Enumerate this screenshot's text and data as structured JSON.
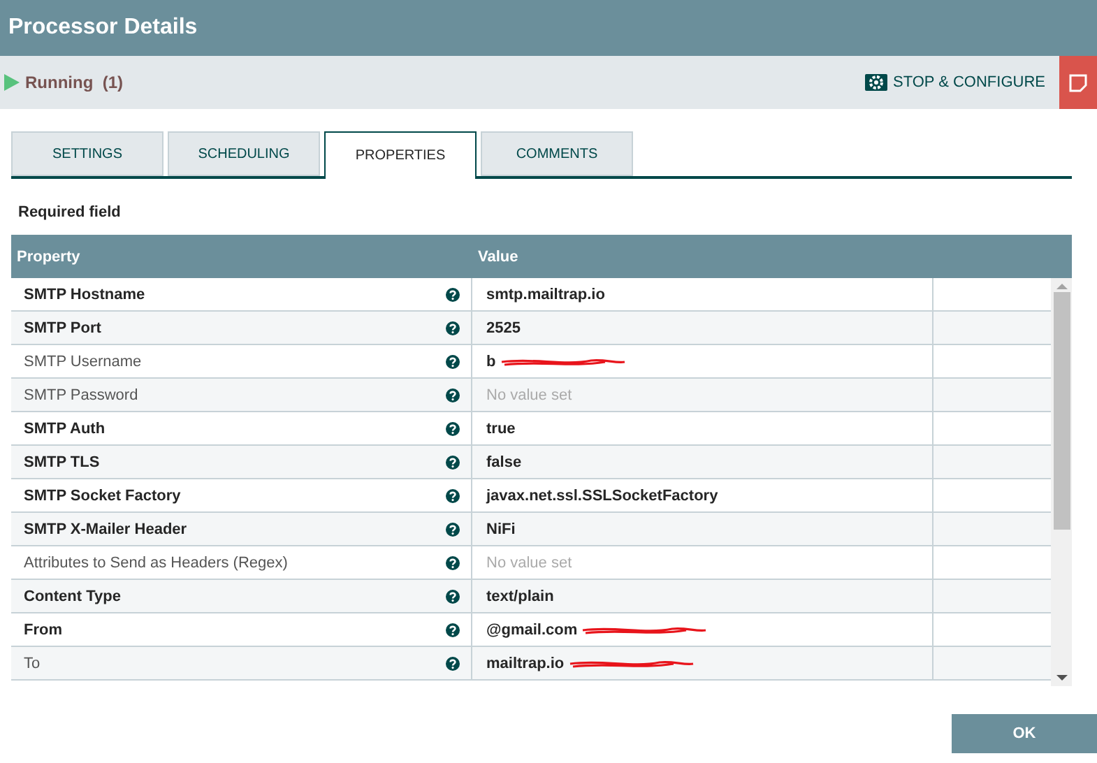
{
  "window": {
    "title": "Processor Details"
  },
  "status": {
    "label": "Running",
    "count": "(1)",
    "running": true
  },
  "toolbar": {
    "stop_configure": "STOP & CONFIGURE"
  },
  "tabs": [
    {
      "label": "SETTINGS",
      "selected": false
    },
    {
      "label": "SCHEDULING",
      "selected": false
    },
    {
      "label": "PROPERTIES",
      "selected": true
    },
    {
      "label": "COMMENTS",
      "selected": false
    }
  ],
  "legend": "Required field",
  "table": {
    "columns": [
      "Property",
      "Value"
    ],
    "rows": [
      {
        "property": "SMTP Hostname",
        "required": true,
        "value": "smtp.mailtrap.io",
        "value_set": true,
        "redacted": false
      },
      {
        "property": "SMTP Port",
        "required": true,
        "value": "2525",
        "value_set": true,
        "redacted": false
      },
      {
        "property": "SMTP Username",
        "required": false,
        "value": "b",
        "value_set": true,
        "redacted": true
      },
      {
        "property": "SMTP Password",
        "required": false,
        "value": "No value set",
        "value_set": false,
        "redacted": false
      },
      {
        "property": "SMTP Auth",
        "required": true,
        "value": "true",
        "value_set": true,
        "redacted": false
      },
      {
        "property": "SMTP TLS",
        "required": true,
        "value": "false",
        "value_set": true,
        "redacted": false
      },
      {
        "property": "SMTP Socket Factory",
        "required": true,
        "value": "javax.net.ssl.SSLSocketFactory",
        "value_set": true,
        "redacted": false
      },
      {
        "property": "SMTP X-Mailer Header",
        "required": true,
        "value": "NiFi",
        "value_set": true,
        "redacted": false
      },
      {
        "property": "Attributes to Send as Headers (Regex)",
        "required": false,
        "value": "No value set",
        "value_set": false,
        "redacted": false
      },
      {
        "property": "Content Type",
        "required": true,
        "value": "text/plain",
        "value_set": true,
        "redacted": false
      },
      {
        "property": "From",
        "required": true,
        "value": "@gmail.com",
        "value_set": true,
        "redacted": true
      },
      {
        "property": "To",
        "required": false,
        "value": "mailtrap.io",
        "value_set": true,
        "redacted": true
      }
    ]
  },
  "buttons": [
    "OK"
  ]
}
